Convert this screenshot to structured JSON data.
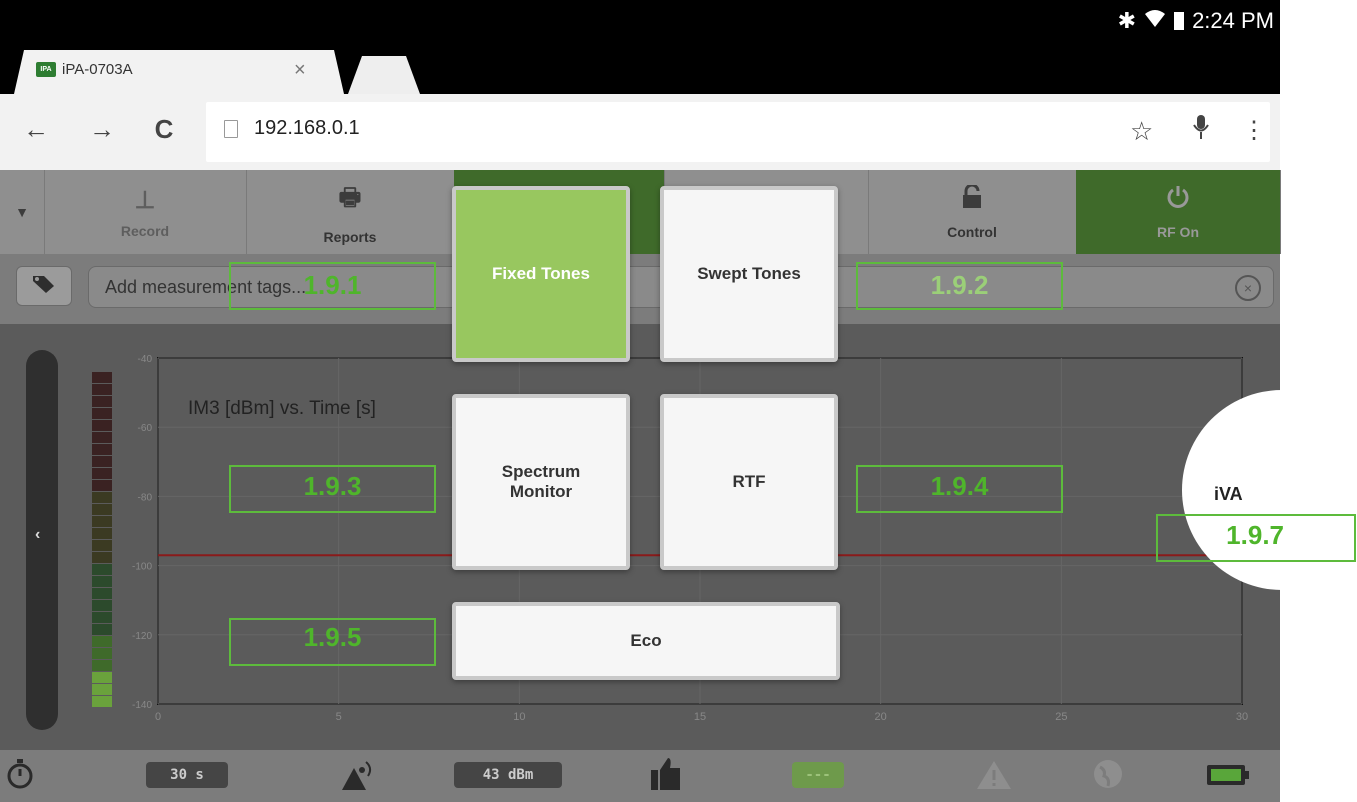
{
  "statusbar": {
    "time": "2:24 PM",
    "bluetooth_icon": "bluetooth-icon",
    "wifi_icon": "wifi-icon",
    "battery_icon": "battery-icon"
  },
  "browser": {
    "tab": {
      "favicon": "IPA",
      "title": "iPA-0703A",
      "close": "×"
    },
    "url": "192.168.0.1",
    "back": "←",
    "forward": "→",
    "reload": "C",
    "bookmark": "☆",
    "mic": "🎙",
    "menu": "⋮"
  },
  "toolbar": {
    "record": "Record",
    "reports": "Reports",
    "control": "Control",
    "rf_on": "RF On"
  },
  "tags": {
    "placeholder": "Add measurement tags..."
  },
  "chart_data": {
    "type": "line",
    "title": "IM3 [dBm] vs. Time [s]",
    "xlabel": "",
    "ylabel": "",
    "xlim": [
      0,
      30
    ],
    "ylim": [
      -140,
      -40
    ],
    "xticks": [
      0,
      5,
      10,
      15,
      20,
      25,
      30
    ],
    "yticks": [
      -40,
      -60,
      -80,
      -100,
      -120,
      -140
    ],
    "series": [
      {
        "x": [
          0,
          30
        ],
        "values": [
          -97,
          -97
        ],
        "color": "#8a1a1a"
      }
    ],
    "grid": true
  },
  "bottombar": {
    "timer": "30 s",
    "power": "43 dBm",
    "status": "---"
  },
  "modes": {
    "fixed_tones": "Fixed Tones",
    "swept_tones": "Swept Tones",
    "spectrum_monitor_l1": "Spectrum",
    "spectrum_monitor_l2": "Monitor",
    "rtf": "RTF",
    "eco": "Eco",
    "iva": "iVA"
  },
  "annotations": {
    "a1": "1.9.1",
    "a2": "1.9.2",
    "a3": "1.9.3",
    "a4": "1.9.4",
    "a5": "1.9.5",
    "a7": "1.9.7"
  },
  "colors": {
    "accent_green": "#98c75f",
    "annotation_green": "#5dbb3c",
    "threshold_line": "#8a1a1a"
  }
}
